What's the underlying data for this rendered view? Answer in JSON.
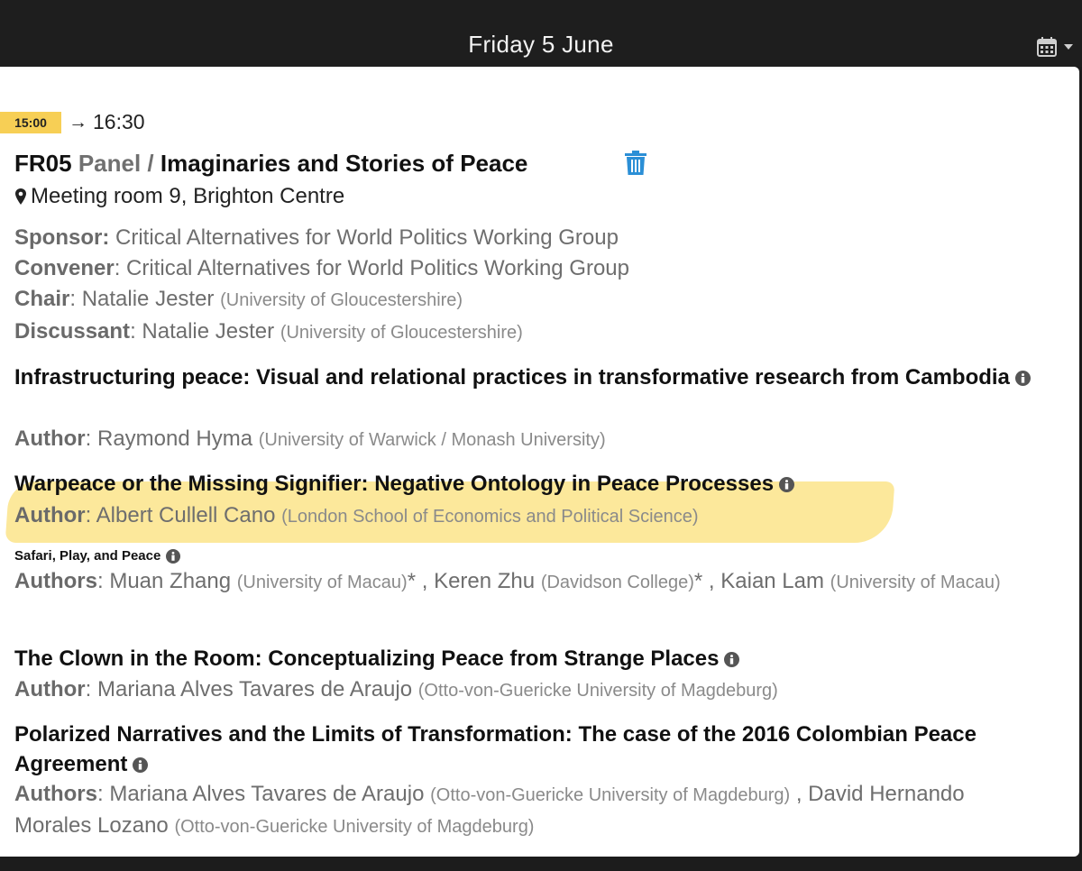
{
  "header": {
    "day_title": "Friday 5 June"
  },
  "session": {
    "start_time": "15:00",
    "arrow": "→",
    "end_time": "16:30",
    "code": "FR05",
    "type": "Panel /",
    "title": "Imaginaries and Stories of Peace",
    "location": "Meeting room 9, Brighton Centre",
    "sponsor_label": "Sponsor:",
    "sponsor": "Critical Alternatives for World Politics Working Group",
    "convener_label": "Convener",
    "convener": ": Critical Alternatives for World Politics Working Group",
    "chair_label": "Chair",
    "chair_name": ": Natalie Jester",
    "chair_aff": "(University of Gloucestershire)",
    "discussant_label": "Discussant",
    "discussant_name": ": Natalie Jester",
    "discussant_aff": "(University of Gloucestershire)"
  },
  "papers": [
    {
      "title": "Infrastructuring peace: Visual and relational practices in transformative research from Cambodia",
      "author_label": "Author",
      "authors_text": ": Raymond Hyma",
      "aff": "(University of Warwick / Monash University)"
    },
    {
      "title": "Warpeace or the Missing Signifier: Negative Ontology in Peace Processes",
      "author_label": "Author",
      "authors_text": ": Albert Cullell Cano",
      "aff": "(London School of Economics and Political Science)"
    },
    {
      "title": "Safari, Play, and Peace",
      "author_label": "Authors",
      "a1": ": Muan Zhang",
      "a1_aff": "(University of Macau)",
      "a1_mark": "* ,",
      "a2": "Keren Zhu",
      "a2_aff": "(Davidson College)",
      "a2_mark": "* ,",
      "a3": "Kaian Lam",
      "a3_aff": "(University of Macau)"
    },
    {
      "title": "The Clown in the Room: Conceptualizing Peace from Strange Places",
      "author_label": "Author",
      "authors_text": ": Mariana Alves Tavares de Araujo",
      "aff": "(Otto-von-Guericke University of Magdeburg)"
    },
    {
      "title": "Polarized Narratives and the Limits of Transformation: The case of the 2016 Colombian Peace Agreement",
      "author_label": "Authors",
      "a1": ": Mariana Alves Tavares de Araujo",
      "a1_aff": "(Otto-von-Guericke University of Magdeburg)",
      "a1_mark": ",",
      "a2": "David Hernando Morales Lozano",
      "a2_aff": "(Otto-von-Guericke University of Magdeburg)"
    }
  ],
  "icons": {
    "calendar": "calendar-icon",
    "trash": "trash-icon",
    "info": "info-icon",
    "pin": "location-pin-icon"
  },
  "colors": {
    "accent_yellow": "#f7cf55",
    "trash_blue": "#2b8fd6",
    "highlight": "#f9d648"
  }
}
